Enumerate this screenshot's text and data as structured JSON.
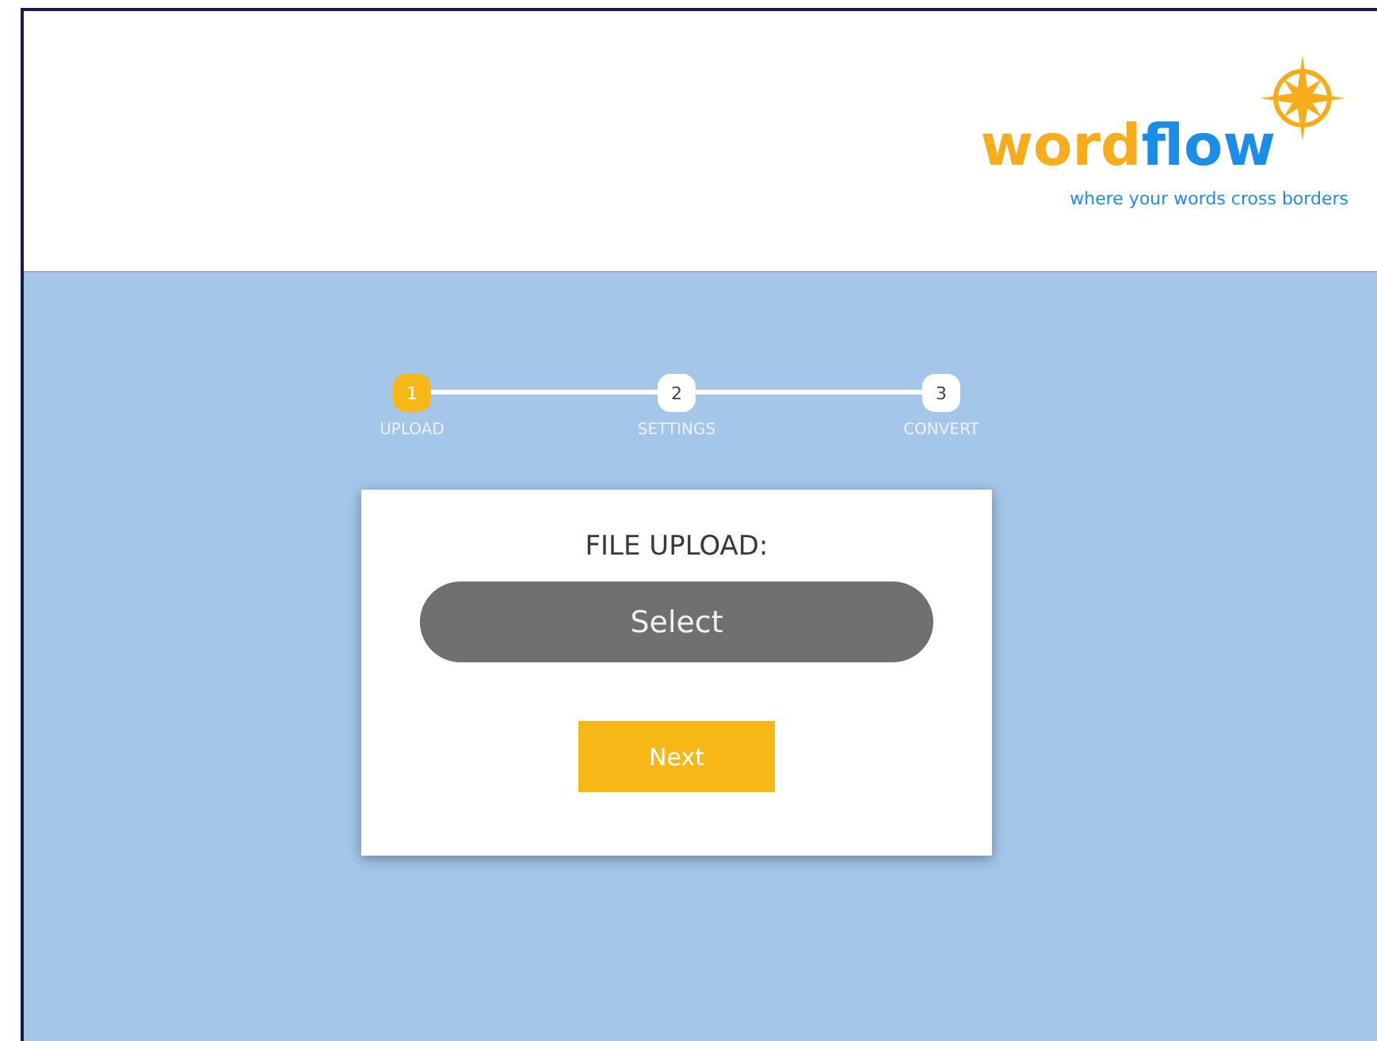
{
  "logo": {
    "parts": [
      {
        "text": "word",
        "color": "#f7ac1b"
      },
      {
        "text": "flow",
        "color": "#1b8de8"
      }
    ],
    "tagline": "where your words cross borders"
  },
  "steps": [
    {
      "number": "1",
      "label": "UPLOAD",
      "selected": true
    },
    {
      "number": "2",
      "label": "SETTINGS",
      "selected": false
    },
    {
      "number": "3",
      "label": "CONVERT",
      "selected": false
    }
  ],
  "card": {
    "title": "FILE UPLOAD:",
    "select_button": "Select",
    "next_button": "Next"
  }
}
